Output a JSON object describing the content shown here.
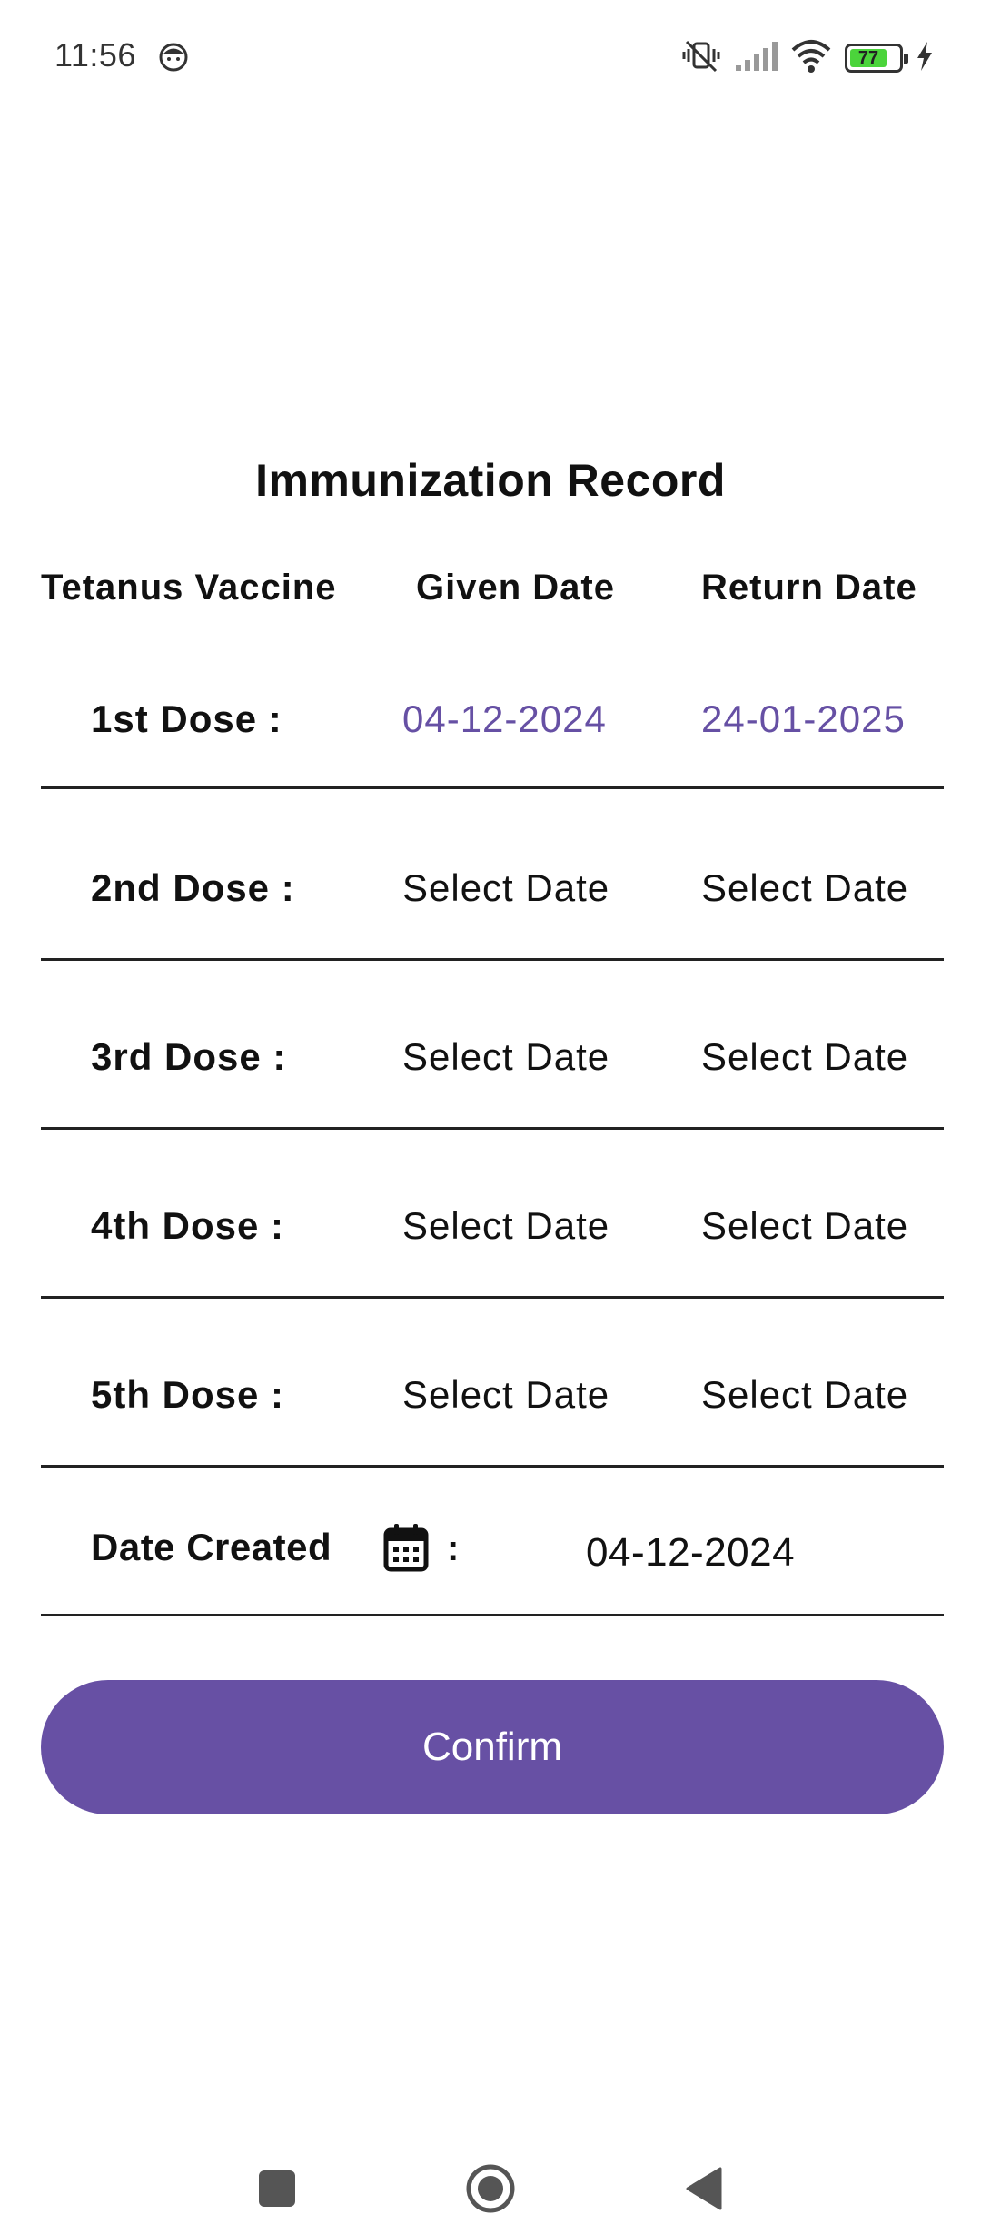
{
  "status_bar": {
    "time": "11:56",
    "battery_level": "77",
    "icons": [
      "face-notification-icon",
      "vibrate-off-icon",
      "signal-icon",
      "wifi-icon",
      "battery-icon",
      "charging-icon"
    ]
  },
  "page": {
    "title": "Immunization Record"
  },
  "table": {
    "headers": {
      "vaccine": "Tetanus Vaccine",
      "given": "Given Date",
      "return": "Return Date"
    },
    "rows": [
      {
        "label": "1st Dose :",
        "given": "04-12-2024",
        "return": "24-01-2025",
        "filled": true
      },
      {
        "label": "2nd Dose :",
        "given": "Select Date",
        "return": "Select Date",
        "filled": false
      },
      {
        "label": "3rd Dose :",
        "given": "Select Date",
        "return": "Select Date",
        "filled": false
      },
      {
        "label": "4th Dose :",
        "given": "Select Date",
        "return": "Select Date",
        "filled": false
      },
      {
        "label": "5th Dose :",
        "given": "Select Date",
        "return": "Select Date",
        "filled": false
      }
    ]
  },
  "date_created": {
    "label": "Date Created",
    "colon": ":",
    "value": "04-12-2024"
  },
  "confirm": {
    "label": "Confirm"
  },
  "colors": {
    "accent": "#6750a4",
    "filled_date": "#6650a4",
    "divider": "#222222"
  },
  "nav": {
    "icons": [
      "recents-square-icon",
      "home-circle-icon",
      "back-triangle-icon"
    ]
  }
}
